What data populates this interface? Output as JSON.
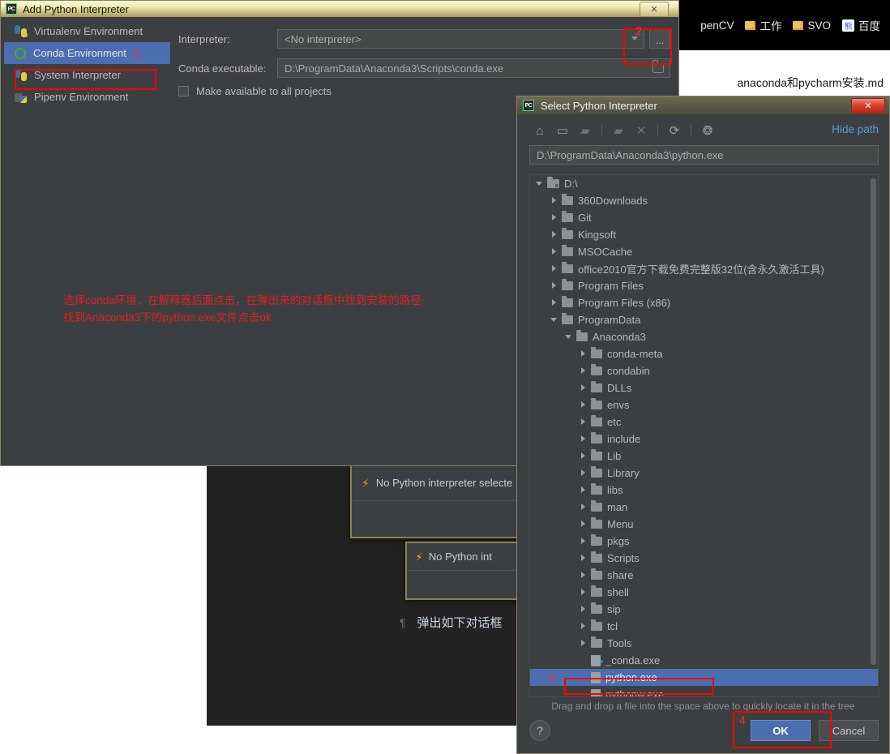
{
  "background": {
    "bookmarks": [
      {
        "label": "penCV",
        "icon": "none"
      },
      {
        "label": "工作",
        "icon": "folder-icon"
      },
      {
        "label": "SVO",
        "icon": "folder-icon"
      },
      {
        "label": "百度",
        "icon": "baidu-icon",
        "glyph": "熊"
      }
    ],
    "document_title": "anaconda和pycharm安装.md",
    "toasts": [
      {
        "icon": "bolt-icon",
        "text": "No Python interpreter selecte"
      },
      {
        "icon": "bolt-icon",
        "text": "No Python int"
      }
    ],
    "md_line": {
      "pilcrow": "¶",
      "text": "弹出如下对话框"
    }
  },
  "add_interpreter_dialog": {
    "title": "Add Python Interpreter",
    "app_icon": "pycharm-icon",
    "app_icon_glyph": "PC",
    "close_label": "✕",
    "env_items": [
      {
        "label": "Virtualenv Environment",
        "icon": "virtualenv-icon",
        "selected": false,
        "marker": ""
      },
      {
        "label": "Conda Environment",
        "icon": "conda-icon",
        "selected": true,
        "marker": "1"
      },
      {
        "label": "System Interpreter",
        "icon": "python-icon",
        "selected": false,
        "marker": ""
      },
      {
        "label": "Pipenv Environment",
        "icon": "pipenv-icon",
        "selected": false,
        "marker": ""
      }
    ],
    "fields": {
      "interpreter_label": "Interpreter:",
      "interpreter_value": "<No interpreter>",
      "browse_label": "...",
      "conda_label": "Conda executable:",
      "conda_value": "D:\\ProgramData\\Anaconda3\\Scripts\\conda.exe"
    },
    "checkbox_label": "Make available to all projects",
    "marker_2": "2"
  },
  "annotation": {
    "line1": "选择conda环境，在解释器后面点击，在弹出来的对话框中找到安装的路径",
    "line2": "找到Anaconda3下的python.exe文件点击ok",
    "color": "#e02020"
  },
  "select_interpreter_dialog": {
    "title": "Select Python Interpreter",
    "app_icon": "pycharm-icon",
    "app_icon_glyph": "PC",
    "close_label": "✕",
    "toolbar": [
      {
        "name": "home-icon",
        "glyph": "⌂",
        "dim": false
      },
      {
        "name": "desktop-icon",
        "glyph": "▭",
        "dim": false
      },
      {
        "name": "project-folder-icon",
        "glyph": "🗀",
        "dim": true
      },
      {
        "name": "new-folder-icon",
        "glyph": "🗀",
        "dim": true
      },
      {
        "name": "delete-icon",
        "glyph": "✕",
        "dim": true
      },
      {
        "name": "refresh-icon",
        "glyph": "⟳",
        "dim": false
      },
      {
        "name": "show-hidden-files-icon",
        "glyph": "◉",
        "dim": false
      }
    ],
    "hide_path_label": "Hide path",
    "path_value": "D:\\ProgramData\\Anaconda3\\python.exe",
    "tree": [
      {
        "label": "D:\\",
        "indent": 0,
        "state": "open",
        "kind": "drive"
      },
      {
        "label": "360Downloads",
        "indent": 1,
        "state": "closed",
        "kind": "folder"
      },
      {
        "label": "Git",
        "indent": 1,
        "state": "closed",
        "kind": "folder"
      },
      {
        "label": "Kingsoft",
        "indent": 1,
        "state": "closed",
        "kind": "folder"
      },
      {
        "label": "MSOCache",
        "indent": 1,
        "state": "closed",
        "kind": "folder"
      },
      {
        "label": "office2010官方下载免费完整版32位(含永久激活工具)",
        "indent": 1,
        "state": "closed",
        "kind": "folder"
      },
      {
        "label": "Program Files",
        "indent": 1,
        "state": "closed",
        "kind": "folder"
      },
      {
        "label": "Program Files (x86)",
        "indent": 1,
        "state": "closed",
        "kind": "folder"
      },
      {
        "label": "ProgramData",
        "indent": 1,
        "state": "open",
        "kind": "folder"
      },
      {
        "label": "Anaconda3",
        "indent": 2,
        "state": "open",
        "kind": "folder"
      },
      {
        "label": "conda-meta",
        "indent": 3,
        "state": "closed",
        "kind": "folder"
      },
      {
        "label": "condabin",
        "indent": 3,
        "state": "closed",
        "kind": "folder"
      },
      {
        "label": "DLLs",
        "indent": 3,
        "state": "closed",
        "kind": "folder"
      },
      {
        "label": "envs",
        "indent": 3,
        "state": "closed",
        "kind": "folder"
      },
      {
        "label": "etc",
        "indent": 3,
        "state": "closed",
        "kind": "folder"
      },
      {
        "label": "include",
        "indent": 3,
        "state": "closed",
        "kind": "folder"
      },
      {
        "label": "Lib",
        "indent": 3,
        "state": "closed",
        "kind": "folder"
      },
      {
        "label": "Library",
        "indent": 3,
        "state": "closed",
        "kind": "folder"
      },
      {
        "label": "libs",
        "indent": 3,
        "state": "closed",
        "kind": "folder"
      },
      {
        "label": "man",
        "indent": 3,
        "state": "closed",
        "kind": "folder"
      },
      {
        "label": "Menu",
        "indent": 3,
        "state": "closed",
        "kind": "folder"
      },
      {
        "label": "pkgs",
        "indent": 3,
        "state": "closed",
        "kind": "folder"
      },
      {
        "label": "Scripts",
        "indent": 3,
        "state": "closed",
        "kind": "folder"
      },
      {
        "label": "share",
        "indent": 3,
        "state": "closed",
        "kind": "folder"
      },
      {
        "label": "shell",
        "indent": 3,
        "state": "closed",
        "kind": "folder"
      },
      {
        "label": "sip",
        "indent": 3,
        "state": "closed",
        "kind": "folder"
      },
      {
        "label": "tcl",
        "indent": 3,
        "state": "closed",
        "kind": "folder"
      },
      {
        "label": "Tools",
        "indent": 3,
        "state": "closed",
        "kind": "folder"
      },
      {
        "label": "_conda.exe",
        "indent": 3,
        "state": "none",
        "kind": "exe"
      },
      {
        "label": "python.exe",
        "indent": 3,
        "state": "none",
        "kind": "exe",
        "selected": true,
        "marker": "3"
      },
      {
        "label": "pythonw.exe",
        "indent": 3,
        "state": "none",
        "kind": "exe"
      }
    ],
    "hint": "Drag and drop a file into the space above to quickly locate it in the tree",
    "help_label": "?",
    "ok_label": "OK",
    "cancel_label": "Cancel",
    "marker_4": "4"
  },
  "colors": {
    "selection_blue": "#4b6eaf",
    "panel_bg": "#3c3f41",
    "annotation_red": "#ff0000",
    "link_blue": "#5b9bd5"
  }
}
